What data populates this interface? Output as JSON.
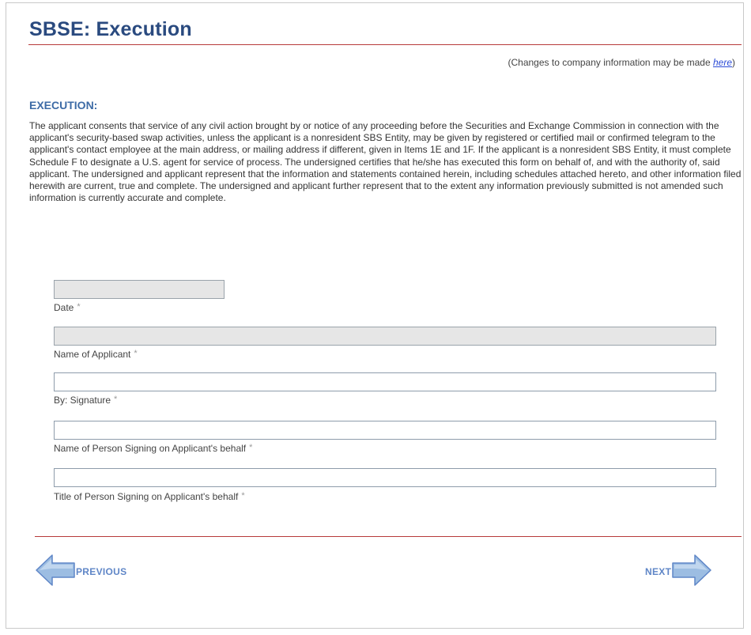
{
  "header": {
    "title": "SBSE: Execution"
  },
  "changes_note": {
    "prefix": "(Changes to company information may be made ",
    "link_text": "here",
    "suffix": ")"
  },
  "section": {
    "heading": "EXECUTION:",
    "consent_text": "The applicant consents that service of any civil action brought by or notice of any proceeding before the Securities and Exchange Commission in connection with the applicant's security-based swap activities, unless the applicant is a nonresident SBS Entity, may be given by registered or certified mail or confirmed telegram to the applicant's contact employee at the main address, or mailing address if different, given in Items 1E and 1F. If the applicant is a nonresident SBS Entity, it must complete Schedule F to designate a U.S. agent for service of process. The undersigned certifies that he/she has executed this form on behalf of, and with the authority of, said applicant. The undersigned and applicant represent that the information and statements contained herein, including schedules attached hereto, and other information filed herewith are current, true and complete. The undersigned and applicant further represent that to the extent any information previously submitted is not amended such information is currently accurate and complete."
  },
  "fields": {
    "date": {
      "label": "Date",
      "value": "",
      "required_mark": "*"
    },
    "name_of_applicant": {
      "label": "Name of Applicant",
      "value": "",
      "required_mark": "*"
    },
    "signature": {
      "label": "By: Signature",
      "value": "",
      "required_mark": "*"
    },
    "name_of_person": {
      "label": "Name of Person Signing on Applicant's behalf",
      "value": "",
      "required_mark": "*"
    },
    "title_of_person": {
      "label": "Title of Person Signing on Applicant's behalf",
      "value": "",
      "required_mark": "*"
    }
  },
  "navigation": {
    "previous_label": "PREVIOUS",
    "next_label": "NEXT",
    "previous_icon": "left-arrow-icon",
    "next_icon": "right-arrow-icon"
  },
  "colors": {
    "title": "#2a4a7f",
    "rule": "#b73a3a",
    "heading": "#3d6ba6",
    "arrow_fill": "#9cbde2",
    "arrow_stroke": "#5f86c7",
    "readonly_field": "#e6e6e6"
  }
}
